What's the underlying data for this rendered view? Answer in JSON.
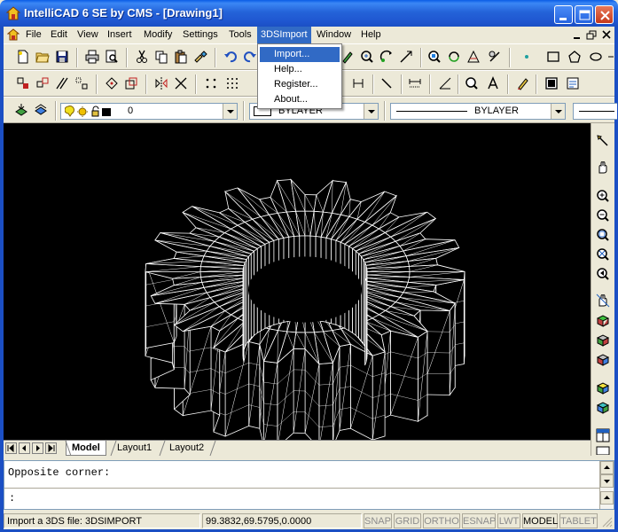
{
  "window": {
    "title": "IntelliCAD 6 SE by CMS - [Drawing1]"
  },
  "menubar": {
    "items": [
      {
        "label": "File"
      },
      {
        "label": "Edit"
      },
      {
        "label": "View"
      },
      {
        "label": "Insert"
      },
      {
        "label": "Modify"
      },
      {
        "label": "Settings"
      },
      {
        "label": "Tools"
      },
      {
        "label": "3DSImport"
      },
      {
        "label": "Window"
      },
      {
        "label": "Help"
      }
    ],
    "active": "3DSImport"
  },
  "dropdown": {
    "items": [
      {
        "label": "Import..."
      },
      {
        "label": "Help..."
      },
      {
        "label": "Register..."
      },
      {
        "label": "About..."
      }
    ],
    "highlighted": "Import..."
  },
  "properties": {
    "layer_value": "0",
    "color_value": "BYLAYER",
    "linetype_value": "BYLAYER"
  },
  "tabs": {
    "items": [
      {
        "label": "Model"
      },
      {
        "label": "Layout1"
      },
      {
        "label": "Layout2"
      }
    ],
    "active": "Model"
  },
  "command": {
    "history": "Opposite corner:",
    "prompt": ":"
  },
  "statusbar": {
    "message": "Import a 3DS file: 3DSIMPORT",
    "coordinates": "99.3832,69.5795,0.0000",
    "toggles": [
      {
        "label": "SNAP",
        "on": false
      },
      {
        "label": "GRID",
        "on": false
      },
      {
        "label": "ORTHO",
        "on": false
      },
      {
        "label": "ESNAP",
        "on": false
      },
      {
        "label": "LWT",
        "on": false
      },
      {
        "label": "MODEL",
        "on": true
      },
      {
        "label": "TABLET",
        "on": false
      }
    ]
  },
  "colors": {
    "titlebar": "#2463d9",
    "menu_highlight": "#316ac5",
    "canvas": "#000000",
    "chrome": "#ece9d8"
  },
  "icons": {
    "app": "intellicad-app-icon",
    "document": "drawing-document-icon"
  }
}
